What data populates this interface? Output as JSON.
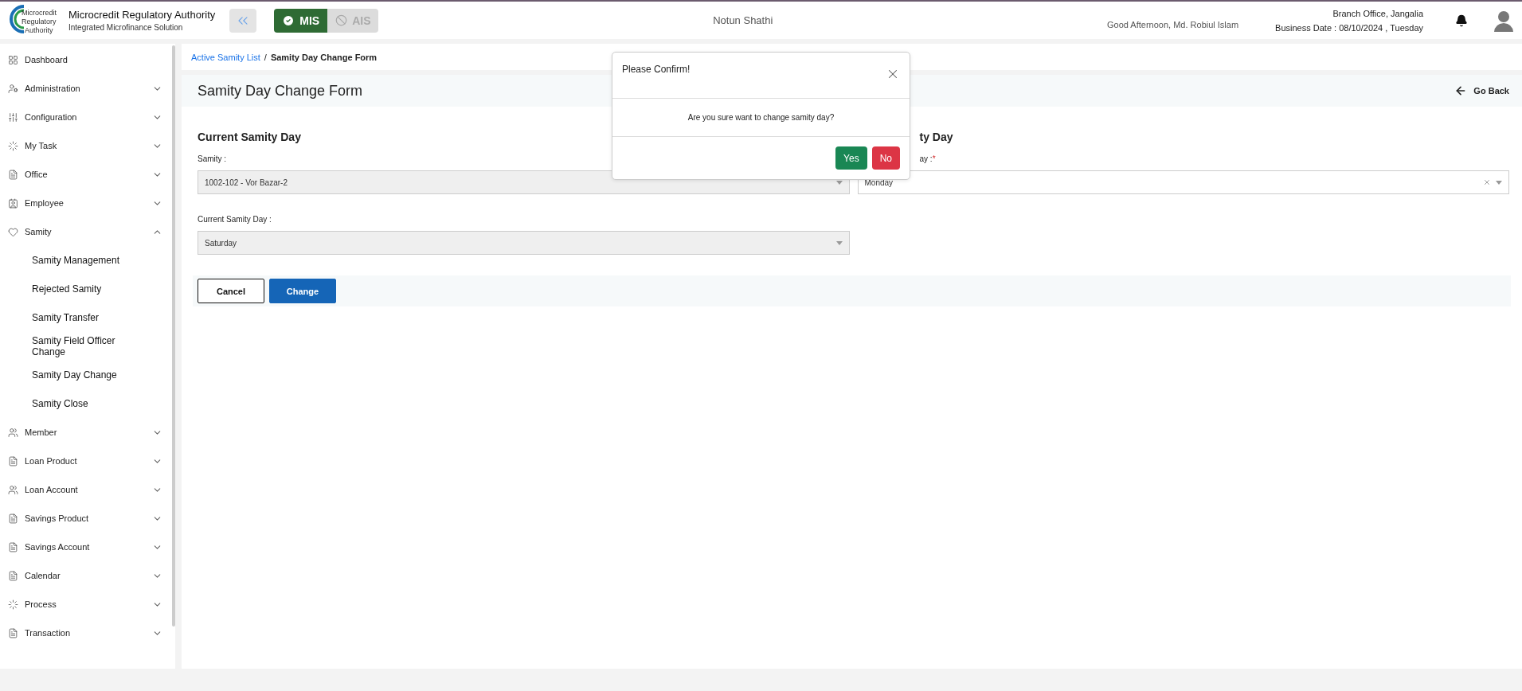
{
  "header": {
    "org_name": "Microcredit Regulatory Authority",
    "org_subtitle": "Integrated Microfinance Solution",
    "logo_text": [
      "Microcredit",
      "Regulatory",
      "Authority"
    ],
    "modules": [
      {
        "label": "MIS",
        "selected": true
      },
      {
        "label": "AIS",
        "selected": false
      }
    ],
    "app_name": "Notun Shathi",
    "greeting": "Good Afternoon, Md. Robiul Islam",
    "branch": "Branch Office, Jangalia",
    "business_date": "Business Date : 08/10/2024 , Tuesday"
  },
  "sidebar": {
    "items": [
      {
        "label": "Dashboard"
      },
      {
        "label": "Administration",
        "expanded": false
      },
      {
        "label": "Configuration",
        "expanded": false
      },
      {
        "label": "My Task",
        "expanded": false
      },
      {
        "label": "Office",
        "expanded": false
      },
      {
        "label": "Employee",
        "expanded": false
      },
      {
        "label": "Samity",
        "expanded": true,
        "children": [
          {
            "label": "Samity Management"
          },
          {
            "label": "Rejected Samity"
          },
          {
            "label": "Samity Transfer"
          },
          {
            "label": "Samity Field Officer Change"
          },
          {
            "label": "Samity Day Change"
          },
          {
            "label": "Samity Close"
          }
        ]
      },
      {
        "label": "Member",
        "expanded": false
      },
      {
        "label": "Loan Product",
        "expanded": false
      },
      {
        "label": "Loan Account",
        "expanded": false
      },
      {
        "label": "Savings Product",
        "expanded": false
      },
      {
        "label": "Savings Account",
        "expanded": false
      },
      {
        "label": "Calendar",
        "expanded": false
      },
      {
        "label": "Process",
        "expanded": false
      },
      {
        "label": "Transaction",
        "expanded": false
      }
    ]
  },
  "breadcrumb": [
    {
      "label": "Active Samity List",
      "link": true
    },
    {
      "label": "Samity Day Change Form",
      "link": false
    }
  ],
  "breadcrumb_separator": "/",
  "page": {
    "title": "Samity Day Change Form",
    "back_label": "Go Back"
  },
  "current": {
    "heading": "Current Samity Day",
    "fields": [
      {
        "label": "Samity :",
        "value": "1002-102 - Vor Bazar-2",
        "disabled": true
      },
      {
        "label": "Current Samity Day :",
        "value": "Saturday",
        "disabled": true
      }
    ]
  },
  "new": {
    "heading": "ty Day",
    "fields": [
      {
        "label": "ay :",
        "required_mark": "*",
        "value": "Monday",
        "disabled": false,
        "clearable": true
      }
    ]
  },
  "buttons": [
    {
      "label": "Cancel",
      "kind": "outline"
    },
    {
      "label": "Change",
      "kind": "primary"
    }
  ],
  "dialog": {
    "title": "Please Confirm!",
    "message": "Are you sure want to change samity day?",
    "buttons": [
      {
        "label": "Yes",
        "kind": "confirm"
      },
      {
        "label": "No",
        "kind": "cancel"
      }
    ]
  }
}
